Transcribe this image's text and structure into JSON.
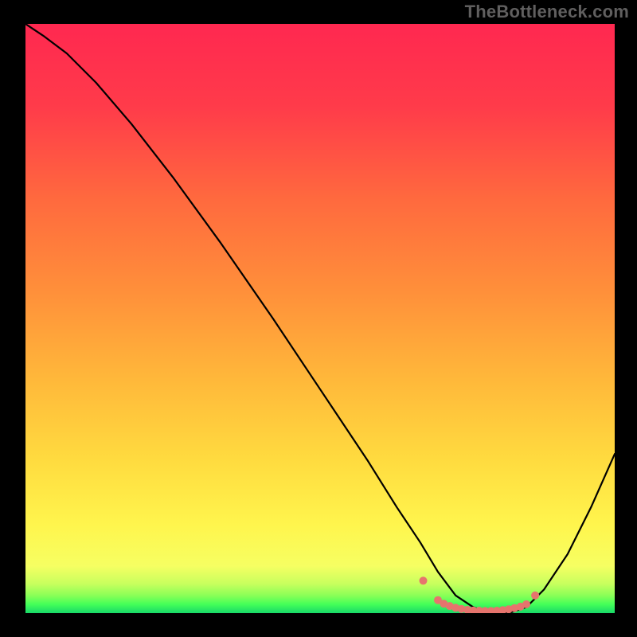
{
  "watermark": "TheBottleneck.com",
  "chart_data": {
    "type": "line",
    "title": "",
    "xlabel": "",
    "ylabel": "",
    "xlim": [
      0,
      100
    ],
    "ylim": [
      0,
      100
    ],
    "grid": false,
    "series": [
      {
        "name": "bottleneck-curve",
        "x": [
          0,
          3,
          7,
          12,
          18,
          25,
          33,
          42,
          50,
          58,
          63,
          67,
          70,
          73,
          76,
          79,
          82,
          85,
          88,
          92,
          96,
          100
        ],
        "y": [
          100,
          98,
          95,
          90,
          83,
          74,
          63,
          50,
          38,
          26,
          18,
          12,
          7,
          3,
          1,
          0,
          0,
          1,
          4,
          10,
          18,
          27
        ]
      }
    ],
    "highlight_dots": {
      "color": "#e6746d",
      "radius_px": 5,
      "x": [
        67.5,
        70,
        71,
        72,
        73,
        74,
        75,
        76,
        77,
        78,
        79,
        80,
        81,
        82,
        83,
        84,
        85,
        86.5
      ],
      "y": [
        5.5,
        2.2,
        1.6,
        1.2,
        0.9,
        0.7,
        0.55,
        0.45,
        0.4,
        0.35,
        0.35,
        0.4,
        0.5,
        0.65,
        0.85,
        1.1,
        1.5,
        3.0
      ]
    }
  }
}
